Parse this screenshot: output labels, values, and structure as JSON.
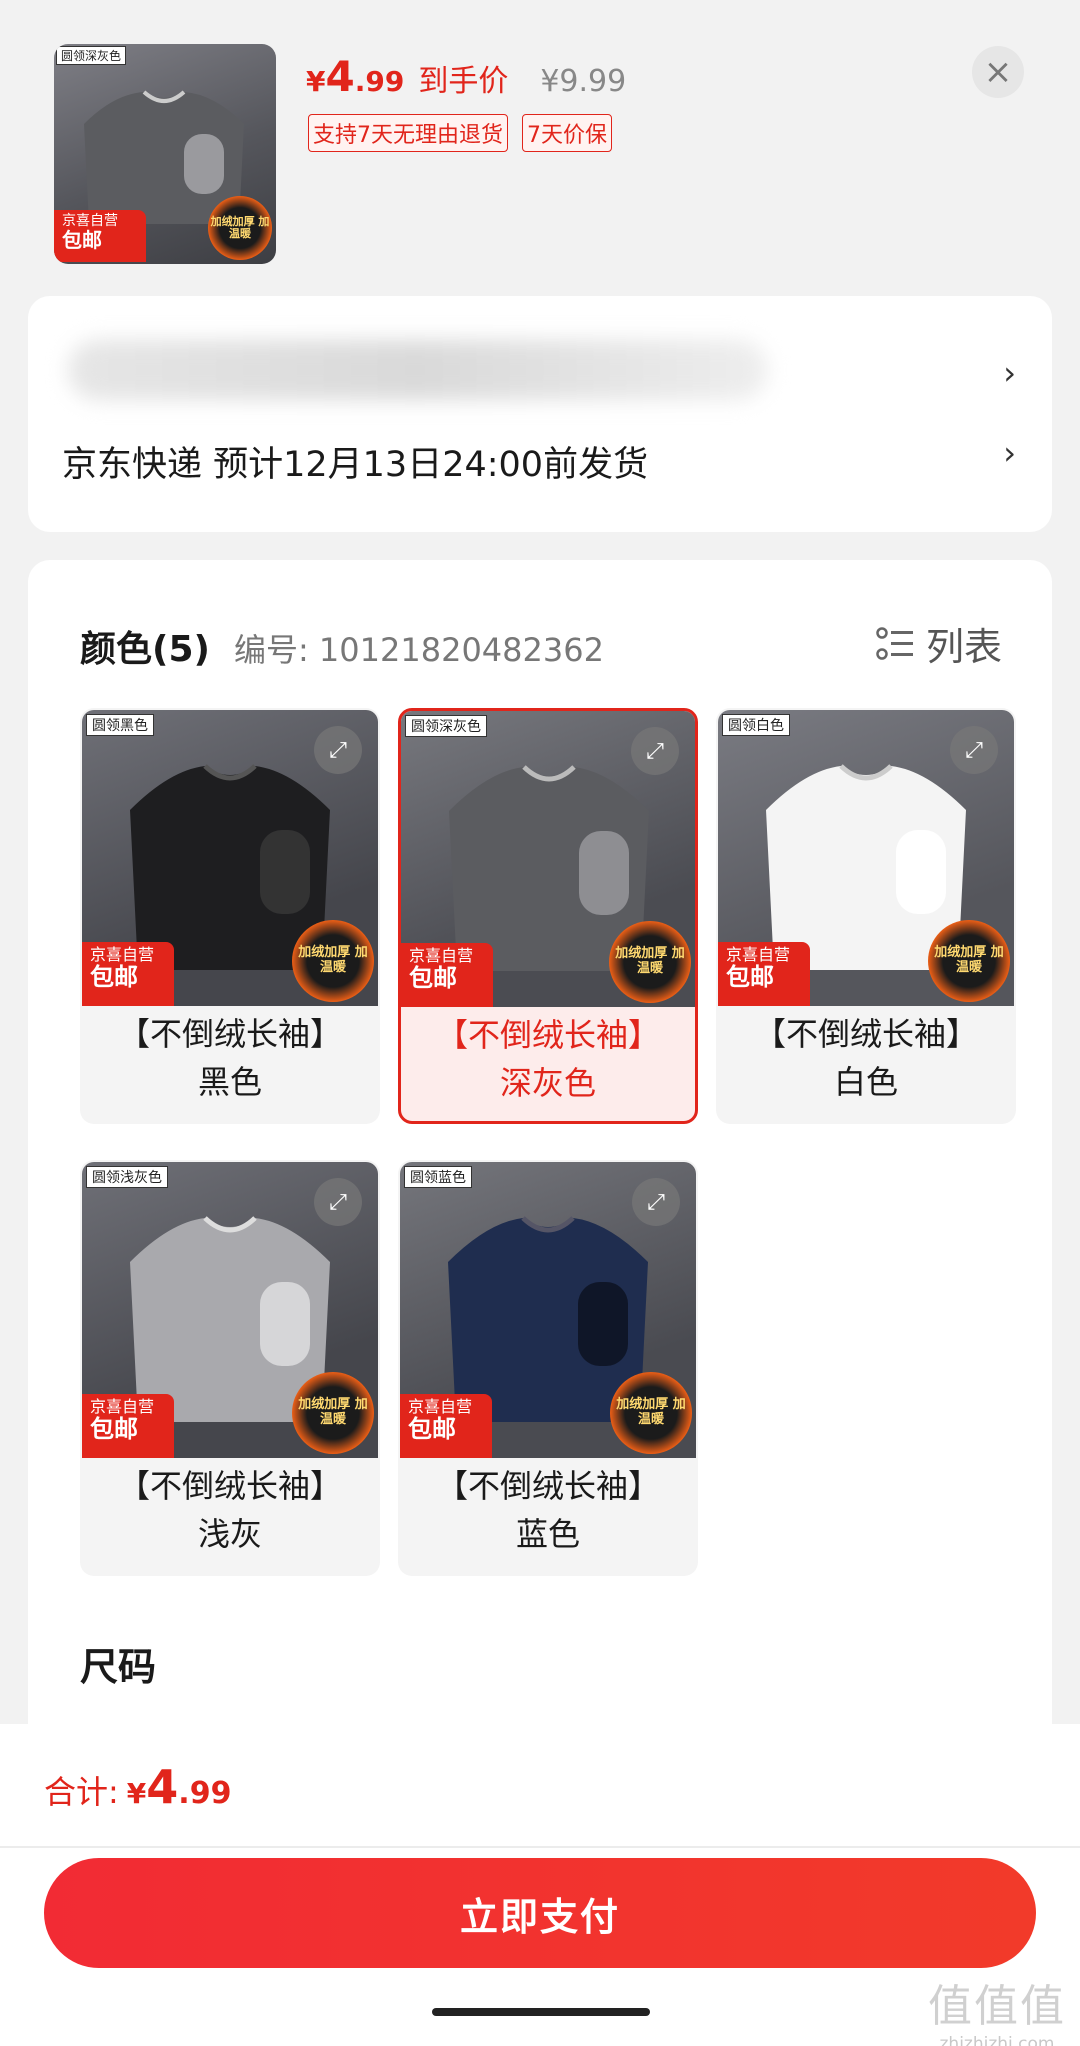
{
  "header": {
    "thumb_tag": "圆领深灰色",
    "jd_line1": "京喜自营",
    "jd_line2": "包邮",
    "flame_text": "加绒加厚 加温暖",
    "price_currency": "¥",
    "price_int": "4",
    "price_dec": ".99",
    "price_label": "到手价",
    "original_price": "¥9.99",
    "badges": [
      "支持7天无理由退货",
      "7天价保"
    ],
    "close_icon": "×"
  },
  "address": {
    "shipping_text": "京东快递 预计12月13日24:00前发货",
    "chevron": "›"
  },
  "options": {
    "color_title": "颜色(5)",
    "sku_text": "编号: 10121820482362",
    "list_label": "列表",
    "variants": [
      {
        "tag": "圆领黑色",
        "line1": "【不倒绒长袖】",
        "line2": "黑色",
        "color": "#1e1e20",
        "selected": false
      },
      {
        "tag": "圆领深灰色",
        "line1": "【不倒绒长袖】",
        "line2": "深灰色",
        "color": "#5b5c60",
        "selected": true
      },
      {
        "tag": "圆领白色",
        "line1": "【不倒绒长袖】",
        "line2": "白色",
        "color": "#f4f4f4",
        "selected": false
      },
      {
        "tag": "圆领浅灰色",
        "line1": "【不倒绒长袖】",
        "line2": "浅灰",
        "color": "#a9a9ad",
        "selected": false
      },
      {
        "tag": "圆领蓝色",
        "line1": "【不倒绒长袖】",
        "line2": "蓝色",
        "color": "#1f2d4f",
        "selected": false
      }
    ],
    "jd_line1": "京喜自营",
    "jd_line2": "包邮",
    "flame_text": "加绒加厚 加温暖",
    "expand_icon": "⤢",
    "size_title": "尺码"
  },
  "bottom": {
    "total_label": "合计:",
    "total_currency": "¥",
    "total_int": "4",
    "total_dec": ".99",
    "pay_label": "立即支付"
  },
  "watermark": {
    "big": "值值值",
    "small": "zhizhizhi.com"
  },
  "colors": {
    "accent": "#e1251b",
    "pay_button": "#f22b34"
  }
}
